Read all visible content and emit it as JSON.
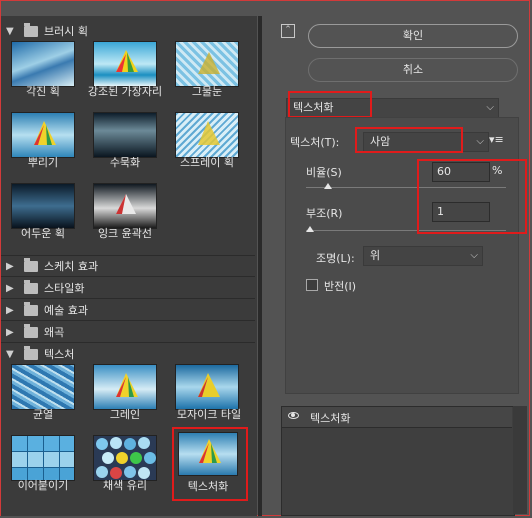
{
  "gallery": {
    "categories": {
      "brush": {
        "label": "브러시 획"
      },
      "sketch": {
        "label": "스케치 효과"
      },
      "stylize": {
        "label": "스타일화"
      },
      "artistic": {
        "label": "예술 효과"
      },
      "distort": {
        "label": "왜곡"
      },
      "texture": {
        "label": "텍스처"
      }
    },
    "brush_items": [
      "각진 획",
      "강조된 가장자리",
      "그물눈",
      "뿌리기",
      "수묵화",
      "스프레이 획",
      "어두운 획",
      "잉크 윤곽선"
    ],
    "texture_items": [
      "균열",
      "그레인",
      "모자이크 타일",
      "이어붙이기",
      "채색 유리",
      "텍스처화"
    ]
  },
  "buttons": {
    "ok": "확인",
    "cancel": "취소"
  },
  "filter_select": "텍스처화",
  "settings": {
    "texture_label": "텍스처(T):",
    "texture_value": "사암",
    "scale_label": "비율(S)",
    "scale_value": "60",
    "scale_unit": "%",
    "relief_label": "부조(R)",
    "relief_value": "1",
    "light_label": "조명(L):",
    "light_value": "위",
    "invert_label": "반전(I)",
    "invert_checked": false,
    "scale_level": 0.06,
    "relief_level": 0.0
  },
  "layers": {
    "row_label": "텍스처화"
  },
  "colors": {
    "highlight": "#e01b1b",
    "panel": "#3b3b3b",
    "bg": "#535353"
  }
}
